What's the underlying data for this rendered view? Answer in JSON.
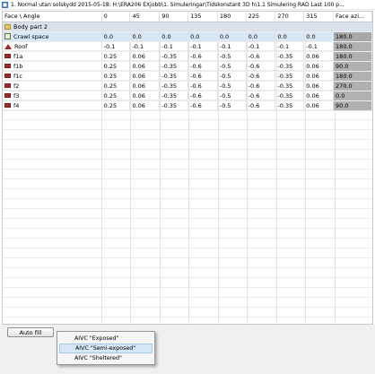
{
  "window": {
    "title": "1. Normal utan solskydd 2015-05-18: H:\\ERA206 EXjobb\\1. Simuleringar\\Tidskonstant 3D h\\1.1 Simulering RAD Last 100 p..."
  },
  "table": {
    "header": {
      "label": "Face \\ Angle",
      "angles": [
        "0",
        "45",
        "90",
        "135",
        "180",
        "225",
        "270",
        "315"
      ],
      "face_azimuth": "Face azi..."
    },
    "group": {
      "label": "Body part 2"
    },
    "rows": [
      {
        "label": "Crawl space",
        "icon": "crawl-space-icon",
        "values": [
          "0.0",
          "0.0",
          "0.0",
          "0.0",
          "0.0",
          "0.0",
          "0.0",
          "0.0"
        ],
        "face": "180.0",
        "selected": true
      },
      {
        "label": "Roof",
        "icon": "roof-icon",
        "values": [
          "-0.1",
          "-0.1",
          "-0.1",
          "-0.1",
          "-0.1",
          "-0.1",
          "-0.1",
          "-0.1"
        ],
        "face": "180.0",
        "selected": false
      },
      {
        "label": "f1a",
        "icon": "wall-icon",
        "values": [
          "0.25",
          "0.06",
          "-0.35",
          "-0.6",
          "-0.5",
          "-0.6",
          "-0.35",
          "0.06"
        ],
        "face": "180.0",
        "selected": false
      },
      {
        "label": "f1b",
        "icon": "wall-icon",
        "values": [
          "0.25",
          "0.06",
          "-0.35",
          "-0.6",
          "-0.5",
          "-0.6",
          "-0.35",
          "0.06"
        ],
        "face": "90.0",
        "selected": false
      },
      {
        "label": "f1c",
        "icon": "wall-icon",
        "values": [
          "0.25",
          "0.06",
          "-0.35",
          "-0.6",
          "-0.5",
          "-0.6",
          "-0.35",
          "0.06"
        ],
        "face": "180.0",
        "selected": false
      },
      {
        "label": "f2",
        "icon": "wall-icon",
        "values": [
          "0.25",
          "0.06",
          "-0.35",
          "-0.6",
          "-0.5",
          "-0.6",
          "-0.35",
          "0.06"
        ],
        "face": "270.0",
        "selected": false
      },
      {
        "label": "f3",
        "icon": "wall-icon",
        "values": [
          "0.25",
          "0.06",
          "-0.35",
          "-0.6",
          "-0.5",
          "-0.6",
          "-0.35",
          "0.06"
        ],
        "face": "0.0",
        "selected": false
      },
      {
        "label": "f4",
        "icon": "wall-icon",
        "values": [
          "0.25",
          "0.06",
          "-0.35",
          "-0.6",
          "-0.5",
          "-0.6",
          "-0.35",
          "0.06"
        ],
        "face": "90.0",
        "selected": false
      }
    ]
  },
  "toolbar": {
    "auto_fill_label": "Auto fill"
  },
  "menu": {
    "items": [
      "AIVC \"Exposed\"",
      "AIVC \"Semi-exposed\"",
      "AIVC \"Sheltered\""
    ],
    "hover_index": 1
  },
  "colors": {
    "group_row_bg": "#d9e1ea",
    "selected_row_bg": "#d8e8f6",
    "face_azimuth_bg": "#b0b0b0",
    "wall_icon": "#a52828",
    "menu_hover": "#d5e6f7"
  }
}
